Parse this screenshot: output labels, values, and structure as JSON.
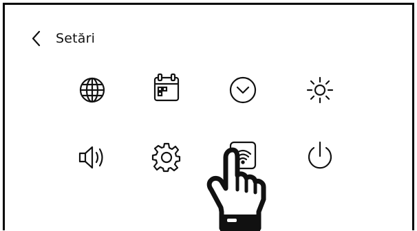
{
  "header": {
    "title": "Setări",
    "back_icon": "chevron-left-icon"
  },
  "settings_grid": {
    "items": [
      {
        "icon": "globe-icon"
      },
      {
        "icon": "calendar-icon"
      },
      {
        "icon": "clock-icon"
      },
      {
        "icon": "brightness-icon"
      },
      {
        "icon": "volume-icon"
      },
      {
        "icon": "gear-icon"
      },
      {
        "icon": "wifi-icon"
      },
      {
        "icon": "power-icon"
      }
    ]
  },
  "overlay": {
    "pointer_icon": "hand-pointer-icon"
  }
}
